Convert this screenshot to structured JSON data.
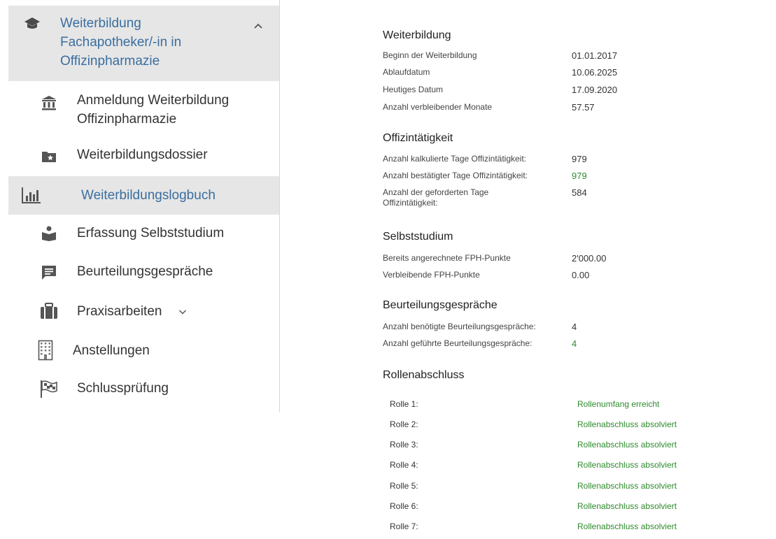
{
  "sidebar": {
    "parent": {
      "title": "Weiterbildung Fachapotheker/-in in Offizinpharmazie",
      "icon": "graduation-cap-icon"
    },
    "items": [
      {
        "label": "Anmeldung Weiterbildung Offizinpharmazie",
        "icon": "bank-icon"
      },
      {
        "label": "Weiterbildungsdossier",
        "icon": "folder-star-icon"
      },
      {
        "label": "Weiterbildungslogbuch",
        "icon": "bar-chart-icon",
        "active": true
      },
      {
        "label": "Erfassung Selbststudium",
        "icon": "reading-person-icon"
      },
      {
        "label": "Beurteilungsgespräche",
        "icon": "chat-icon"
      },
      {
        "label": "Praxisarbeiten",
        "icon": "briefcase-icon"
      },
      {
        "label": "Anstellungen",
        "icon": "building-icon"
      },
      {
        "label": "Schlussprüfung",
        "icon": "checkered-flag-icon"
      }
    ]
  },
  "weiterbildung": {
    "title": "Weiterbildung",
    "rows": [
      {
        "label": "Beginn der Weiterbildung",
        "value": "01.01.2017"
      },
      {
        "label": "Ablaufdatum",
        "value": "10.06.2025"
      },
      {
        "label": "Heutiges Datum",
        "value": "17.09.2020"
      },
      {
        "label": "Anzahl verbleibender Monate",
        "value": "57.57"
      }
    ]
  },
  "offizin": {
    "title": "Offizintätigkeit",
    "rows": [
      {
        "label": "Anzahl kalkulierte Tage Offizintätigkeit:",
        "value": "979"
      },
      {
        "label": "Anzahl bestätigter Tage Offizintätigkeit:",
        "value": "979"
      },
      {
        "label": "Anzahl der geforderten Tage Offizintätigkeit:",
        "value": "584"
      }
    ]
  },
  "selbststudium": {
    "title": "Selbststudium",
    "rows": [
      {
        "label": "Bereits angerechnete FPH-Punkte",
        "value": "2'000.00"
      },
      {
        "label": "Verbleibende FPH-Punkte",
        "value": "0.00"
      }
    ]
  },
  "beurteilung": {
    "title": "Beurteilungsgespräche",
    "rows": [
      {
        "label": "Anzahl benötigte Beurteilungsgespräche:",
        "value": "4"
      },
      {
        "label": "Anzahl geführte Beurteilungsgespräche:",
        "value": "4"
      }
    ]
  },
  "rollen": {
    "title": "Rollenabschluss",
    "rows": [
      {
        "label": "Rolle 1:",
        "value": "Rollenumfang erreicht"
      },
      {
        "label": "Rolle 2:",
        "value": "Rollenabschluss absolviert"
      },
      {
        "label": "Rolle 3:",
        "value": "Rollenabschluss absolviert"
      },
      {
        "label": "Rolle 4:",
        "value": "Rollenabschluss absolviert"
      },
      {
        "label": "Rolle 5:",
        "value": "Rollenabschluss absolviert"
      },
      {
        "label": "Rolle 6:",
        "value": "Rollenabschluss absolviert"
      },
      {
        "label": "Rolle 7:",
        "value": "Rollenabschluss absolviert"
      }
    ]
  },
  "colors": {
    "accent": "#3a6ea0",
    "success": "#2e8b2e",
    "active_bg": "#e6e6e6"
  }
}
